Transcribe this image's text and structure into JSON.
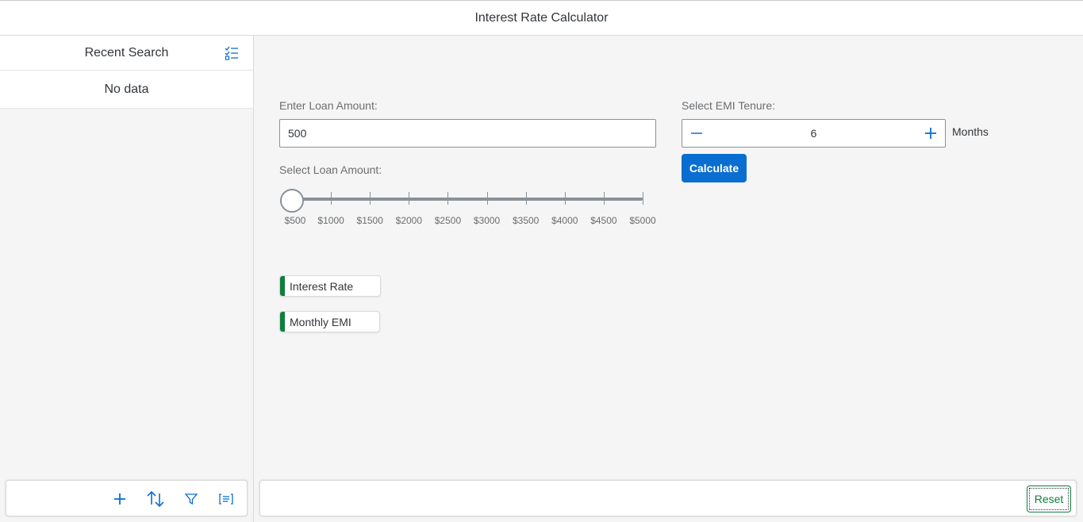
{
  "header": {
    "title": "Interest Rate Calculator"
  },
  "master": {
    "title": "Recent Search",
    "no_data_text": "No data",
    "footer_icons": [
      "add-icon",
      "sort-icon",
      "filter-icon",
      "group-icon"
    ]
  },
  "form": {
    "loan_amount_label": "Enter Loan Amount:",
    "loan_amount_value": "500",
    "slider_label": "Select Loan Amount:",
    "slider_value": 500,
    "slider_min": 500,
    "slider_max": 5000,
    "slider_ticks": [
      "$500",
      "$1000",
      "$1500",
      "$2000",
      "$2500",
      "$3000",
      "$3500",
      "$4000",
      "$4500",
      "$5000"
    ],
    "tenure_label": "Select EMI Tenure:",
    "tenure_value": "6",
    "tenure_unit": "Months",
    "calculate_label": "Calculate"
  },
  "results": {
    "interest_rate_label": "Interest Rate",
    "monthly_emi_label": "Monthly EMI",
    "status_color": "#107e3e"
  },
  "footer": {
    "reset_label": "Reset"
  },
  "colors": {
    "accent": "#0a6ed1",
    "positive": "#107e3e"
  }
}
